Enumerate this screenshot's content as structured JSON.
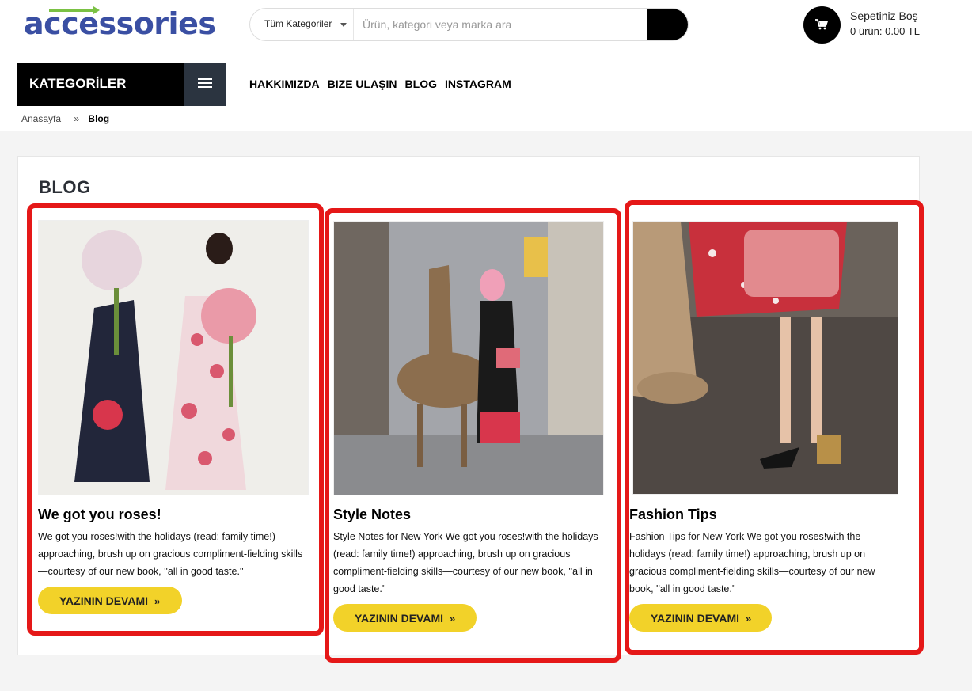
{
  "header": {
    "logo_text": "accessories",
    "search": {
      "category": "Tüm Kategoriler",
      "placeholder": "Ürün, kategori veya marka ara"
    },
    "cart": {
      "title": "Sepetiniz Boş",
      "summary": "0 ürün: 0.00 TL"
    }
  },
  "nav": {
    "categories_label": "KATEGORİLER",
    "menu": [
      "HAKKIMIZDA",
      "BIZE ULAŞIN",
      "BLOG",
      "INSTAGRAM"
    ]
  },
  "breadcrumb": {
    "home": "Anasayfa",
    "separator": "»",
    "current": "Blog"
  },
  "page": {
    "title": "BLOG"
  },
  "posts": [
    {
      "title": "We got you roses!",
      "excerpt": "We got you roses!with the holidays (read: family time!) approaching, brush up on gracious compliment-fielding skills—courtesy of our new book, ''all in good taste.''",
      "button": "YAZININ DEVAMI",
      "button_icon": "»"
    },
    {
      "title": "Style Notes",
      "excerpt": "Style Notes for New York We got you roses!with the holidays (read: family time!) approaching, brush up on gracious compliment-fielding skills—courtesy of our new book, ''all in good taste.''",
      "button": "YAZININ DEVAMI",
      "button_icon": "»"
    },
    {
      "title": "Fashion Tips",
      "excerpt": "Fashion Tips for New York We got you roses!with the holidays (read: family time!) approaching, brush up on gracious compliment-fielding skills—courtesy of our new book, ''all in good taste.''",
      "button": "YAZININ DEVAMI",
      "button_icon": "»"
    }
  ],
  "colors": {
    "accent_yellow": "#f2d229",
    "highlight_red": "#e51818",
    "logo_blue": "#3a4fa3",
    "logo_green": "#7ac143"
  }
}
